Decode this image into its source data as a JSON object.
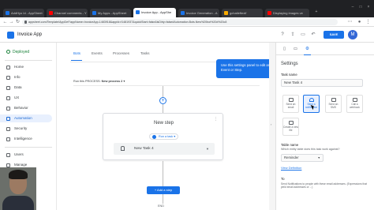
{
  "browser": {
    "tabs": [
      {
        "title": "AddHyo Id - AppSheet",
        "favicon_color": "#1a73e8"
      },
      {
        "title": "Channel comments - Y",
        "favicon_color": "#ff0000"
      },
      {
        "title": "My Apps - AppSheet",
        "favicon_color": "#1a73e8"
      },
      {
        "title": "Invoice App - AppShe",
        "favicon_color": "#1a73e8"
      },
      {
        "title": "Invoice Generation - A",
        "favicon_color": "#1a73e8"
      },
      {
        "title": "gchatleftexif",
        "favicon_color": "#f9ab00"
      },
      {
        "title": "Displaying images ve",
        "favicon_color": "#ff0000"
      }
    ],
    "active_tab_index": 3,
    "url": "appsheet.com/Template/AppDef?appName=InvoiceApp-1483918&appId=f1481937&quickStart=false&isDirty=false#Automation.Bots.New%20bot%20d%20c8"
  },
  "app": {
    "name": "Invoice App",
    "save_label": "SAVE",
    "avatar_initial": "M"
  },
  "sidebar": {
    "status": "Deployed",
    "items": [
      {
        "label": "Home",
        "active": false
      },
      {
        "label": "Info",
        "active": false
      },
      {
        "label": "Data",
        "active": false
      },
      {
        "label": "UX",
        "active": false
      },
      {
        "label": "Behavior",
        "active": false
      },
      {
        "label": "Automation",
        "active": true
      },
      {
        "label": "Security",
        "active": false
      },
      {
        "label": "Intelligence",
        "active": false
      },
      {
        "label": "Users",
        "active": false
      },
      {
        "label": "Manage",
        "active": false
      }
    ]
  },
  "main": {
    "tabs": [
      "Bots",
      "Events",
      "Processes",
      "Tasks"
    ],
    "active_tab": "Bots",
    "run_text_prefix": "Run this PROCESS: ",
    "run_process": "New process 2",
    "step_title": "New step",
    "run_task_label": "Run a task",
    "task_value": "New Task 4",
    "add_step_label": "+ Add a step",
    "end_label": "END"
  },
  "tooltip": {
    "text": "Use this settings panel to edit an Event or Step."
  },
  "settings": {
    "heading": "Settings",
    "task_name_label": "Task name",
    "task_name_value": "New Task 4",
    "task_types": [
      {
        "label": "Send an email",
        "selected": false,
        "icon": "mail-icon"
      },
      {
        "label": "Send a notification",
        "selected": true,
        "icon": "bell-icon"
      },
      {
        "label": "Send an SMS",
        "selected": false,
        "icon": "sms-icon"
      },
      {
        "label": "Call a webhook",
        "selected": false,
        "icon": "webhook-icon"
      },
      {
        "label": "Create a new file",
        "selected": false,
        "icon": "file-icon"
      }
    ],
    "table_name_label": "Table name",
    "table_name_help": "Which entity table does this task work against?",
    "table_name_value": "Reminder",
    "view_definition": "View Definition",
    "to_label": "To",
    "to_desc": "Send Notifications to people with these email addresses. (Expressions that yield email addresses or ...)"
  },
  "colors": {
    "accent": "#1a73e8",
    "deployed": "#188038",
    "tab_strip": "#202124"
  }
}
